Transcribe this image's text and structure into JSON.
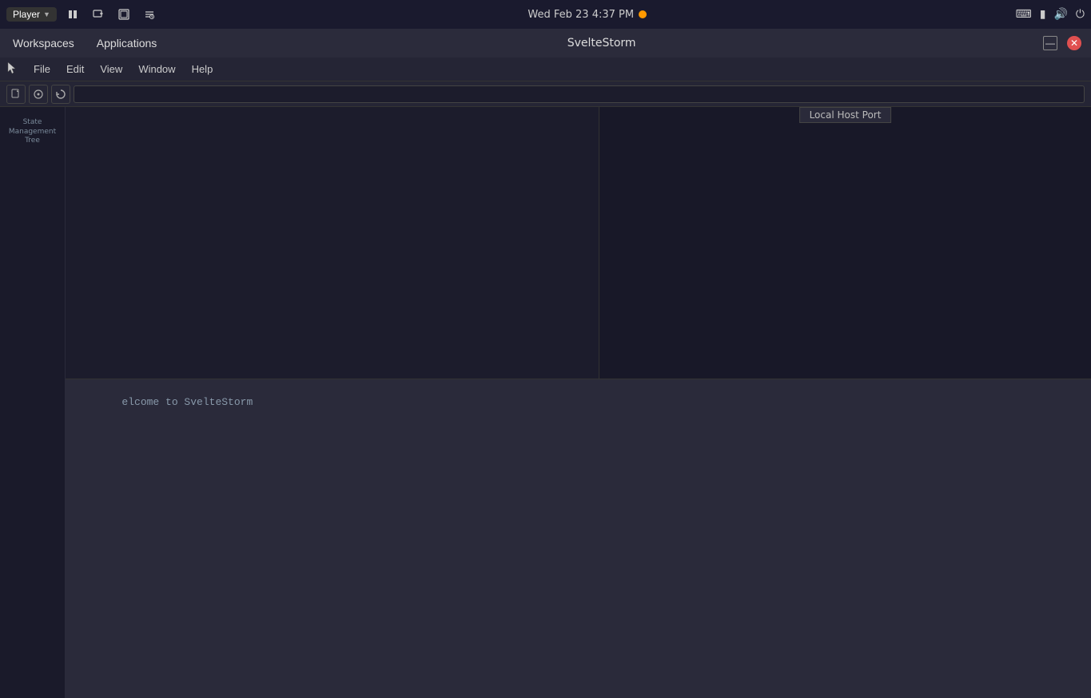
{
  "system_bar": {
    "player_label": "Player",
    "workspaces_label": "Workspaces",
    "applications_label": "Applications",
    "datetime": "Wed Feb 23   4:37 PM",
    "minimize_icon": "—",
    "close_icon": "✕",
    "power_icon": "⏻"
  },
  "app_bar": {
    "title": "SvelteStorm",
    "minimize_label": "—",
    "close_label": "✕"
  },
  "menu": {
    "file_label": "File",
    "edit_label": "Edit",
    "view_label": "View",
    "window_label": "Window",
    "help_label": "Help"
  },
  "toolbar": {
    "new_icon": "□",
    "open_icon": "⊙",
    "refresh_icon": "↺",
    "url_placeholder": "",
    "url_value": ""
  },
  "sidebar": {
    "state_management_tree_label": "State\nManagement\nTree"
  },
  "preview": {
    "local_host_port_label": "Local Host Port"
  },
  "terminal": {
    "welcome_text": "elcome to SvelteStorm"
  }
}
